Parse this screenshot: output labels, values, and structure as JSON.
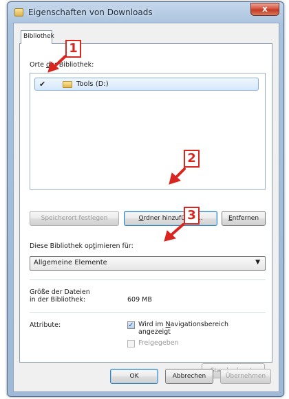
{
  "window": {
    "title": "Eigenschaften von Downloads",
    "close_label": "x"
  },
  "tabs": [
    {
      "label": "Bibliothek",
      "selected": true
    }
  ],
  "locations": {
    "label_prefix": "Orte ",
    "label_mnemonic": "d",
    "label_suffix": "er Bibliothek:",
    "items": [
      {
        "check": "✔",
        "name": "Tools (D:)"
      }
    ]
  },
  "location_buttons": {
    "set_save_location": "Speicherort festlegen",
    "add_folder_mnemonic": "O",
    "add_folder_rest": "rdner hinzufügen...",
    "remove_mnemonic": "E",
    "remove_rest": "ntfernen"
  },
  "optimize": {
    "label_prefix": "Diese Bibliothek op",
    "label_mnemonic": "t",
    "label_suffix": "imieren für:",
    "selected_value": "Allgemeine Elemente",
    "dropdown_arrow": "▼"
  },
  "size": {
    "label": "Größe der Dateien in der Bibliothek:",
    "value": "609 MB"
  },
  "attributes": {
    "label": "Attribute:",
    "show_in_nav_prefix": "Wird im ",
    "show_in_nav_mnemonic": "N",
    "show_in_nav_suffix": "avigationsbereich angezeigt",
    "show_in_nav_checked": true,
    "check_mark": "✓",
    "shared": "Freigegeben",
    "shared_checked": false
  },
  "restore_defaults": "Standardwerte",
  "dialog_buttons": {
    "ok": "OK",
    "cancel": "Abbrechen",
    "apply": "Übernehmen"
  },
  "annotations": {
    "marker_color": "#d8251f",
    "markers": [
      "1",
      "2",
      "3"
    ]
  }
}
